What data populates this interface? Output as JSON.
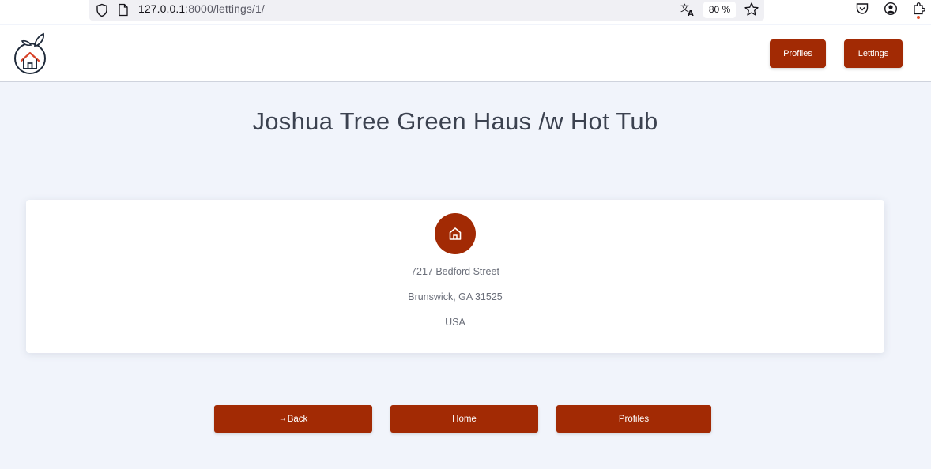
{
  "browser": {
    "url_host": "127.0.0.1",
    "url_rest": ":8000/lettings/1/",
    "zoom": "80 %"
  },
  "header": {
    "nav": {
      "profiles_label": "Profiles",
      "lettings_label": "Lettings"
    }
  },
  "main": {
    "title": "Joshua Tree Green Haus /w Hot Tub",
    "address": {
      "street": "7217 Bedford Street",
      "city_line": "Brunswick, GA 31525",
      "country": "USA"
    },
    "buttons": {
      "back_arrow": "→",
      "back_label": "Back",
      "home_label": "Home",
      "profiles_label": "Profiles"
    }
  },
  "icons": {
    "logo": "orange-house-logo-icon",
    "card": "home-icon"
  },
  "colors": {
    "accent": "#a22a04",
    "background": "#f1f4fb",
    "title_text": "#3c4250",
    "muted_text": "#6b6f7a"
  }
}
